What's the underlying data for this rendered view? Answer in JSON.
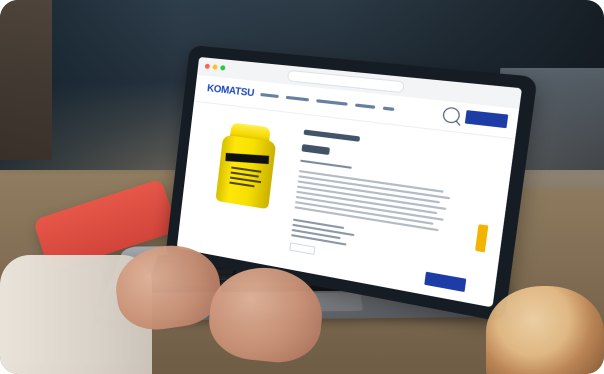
{
  "image": {
    "type": "photo",
    "subject": "laptop-on-cafe-table",
    "visible_screen_text": {
      "brand": "KOMATSU"
    }
  },
  "colors": {
    "brand_blue": "#1d48b8",
    "button_blue": "#1d3ca5",
    "accent_yellow": "#f2b400",
    "phone_red": "#d94b3f"
  },
  "icons": {
    "search": "search-icon"
  }
}
